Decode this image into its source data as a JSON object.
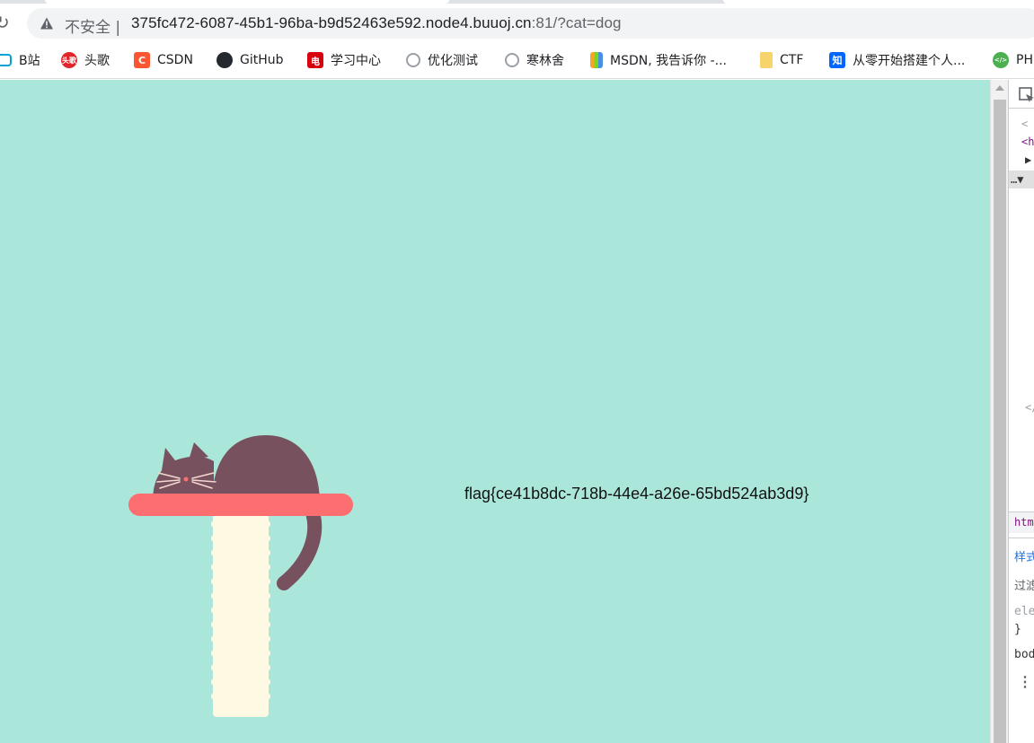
{
  "browser": {
    "security_label": "不安全 |",
    "url_host": "375fc472-6087-45b1-96ba-b9d52463e592.node4.buuoj.cn",
    "url_rest": ":81/?cat=dog"
  },
  "bookmarks": [
    {
      "label": "B站",
      "icon": "bilibili-icon",
      "color": "#00a1d6"
    },
    {
      "label": "头歌",
      "icon": "touge-icon",
      "color": "#e0262b"
    },
    {
      "label": "CSDN",
      "icon": "csdn-icon",
      "color": "#fc5531"
    },
    {
      "label": "GitHub",
      "icon": "github-icon",
      "color": "#24292f"
    },
    {
      "label": "学习中心",
      "icon": "study-center-icon",
      "color": "#d7000f"
    },
    {
      "label": "优化测试",
      "icon": "globe-icon",
      "color": "#9aa0a6"
    },
    {
      "label": "寒林舍",
      "icon": "globe-icon",
      "color": "#9aa0a6"
    },
    {
      "label": "MSDN, 我告诉你 -...",
      "icon": "msdn-icon",
      "color": "#f5a623"
    },
    {
      "label": "CTF",
      "icon": "folder-icon",
      "color": "#f6d36b"
    },
    {
      "label": "从零开始搭建个人...",
      "icon": "zhihu-icon",
      "color": "#0066ff"
    },
    {
      "label": "PH",
      "icon": "php-icon",
      "color": "#4caf50"
    }
  ],
  "page": {
    "flag_text": "flag{ce41b8dc-718b-44e4-a26e-65bd524ab3d9}",
    "background": "#abe6db",
    "cat_color": "#77515d",
    "shelf_color": "#fc6e70",
    "post_color": "#fdf9e3"
  },
  "devtools": {
    "lines": [
      "<",
      "<h",
      "▶",
      "…▼",
      "</"
    ],
    "breadcrumb": "htm",
    "styles_tab": "样式",
    "filter_label": "过滤",
    "rule_selector": "ele",
    "rule_close": "}",
    "body_label": "bod"
  }
}
